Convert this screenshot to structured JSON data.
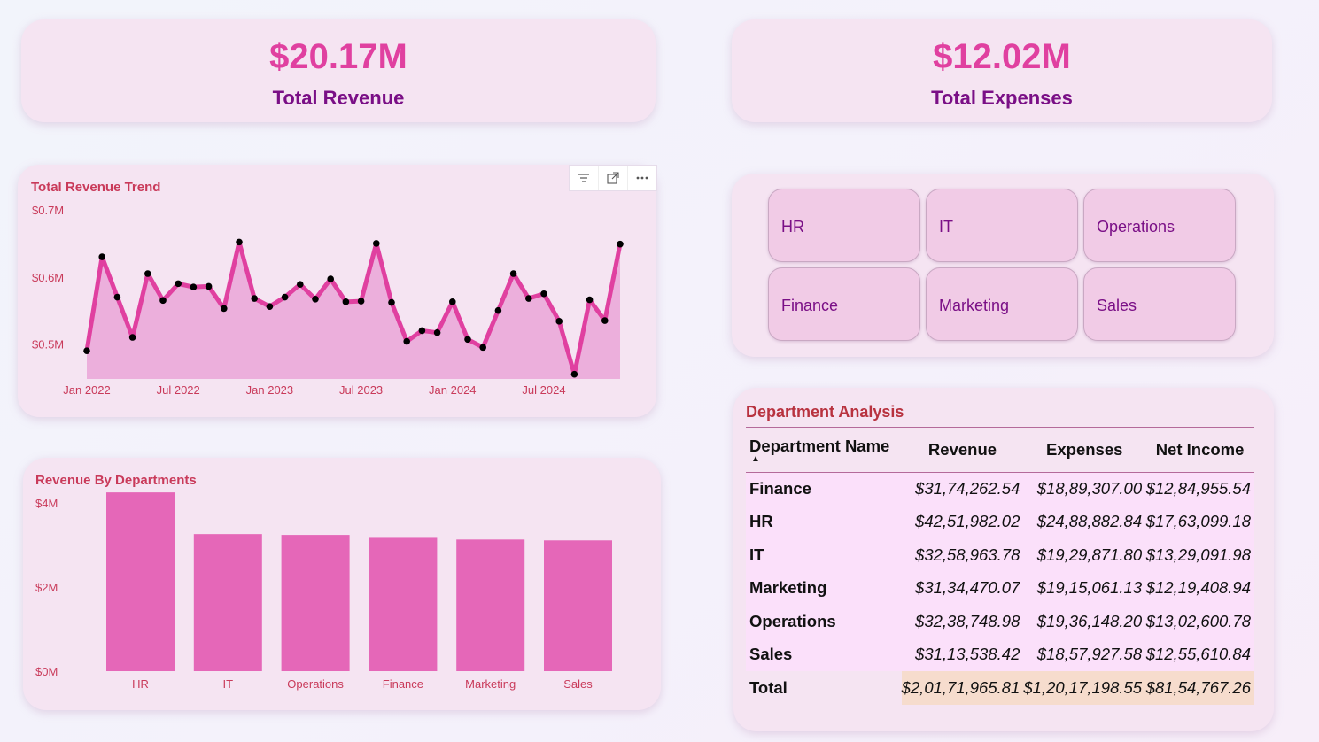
{
  "kpis": [
    {
      "value": "$20.17M",
      "label": "Total Revenue"
    },
    {
      "value": "$12.02M",
      "label": "Total Expenses"
    }
  ],
  "toolbar": {
    "filter_icon": "filter-icon",
    "focus_icon": "focus-mode-icon",
    "more_icon": "more-options-icon"
  },
  "slicer": {
    "items": [
      "HR",
      "IT",
      "Operations",
      "Finance",
      "Marketing",
      "Sales"
    ]
  },
  "table": {
    "title": "Department Analysis",
    "headers": [
      "Department Name",
      "Revenue",
      "Expenses",
      "Net Income"
    ],
    "sort_indicator": "▲",
    "rows": [
      [
        "Finance",
        "$31,74,262.54",
        "$18,89,307.00",
        "$12,84,955.54"
      ],
      [
        "HR",
        "$42,51,982.02",
        "$24,88,882.84",
        "$17,63,099.18"
      ],
      [
        "IT",
        "$32,58,963.78",
        "$19,29,871.80",
        "$13,29,091.98"
      ],
      [
        "Marketing",
        "$31,34,470.07",
        "$19,15,061.13",
        "$12,19,408.94"
      ],
      [
        "Operations",
        "$32,38,748.98",
        "$19,36,148.20",
        "$13,02,600.78"
      ],
      [
        "Sales",
        "$31,13,538.42",
        "$18,57,927.58",
        "$12,55,610.84"
      ]
    ],
    "total": [
      "Total",
      "$2,01,71,965.81",
      "$1,20,17,198.55",
      "$81,54,767.26"
    ]
  },
  "colors": {
    "accent": "#e040a0",
    "title": "#7a0f86",
    "line": "#e040a0",
    "area": "#eaa6d8",
    "bar": "#e567b8",
    "axis_text": "#c93a5a"
  },
  "chart_data": [
    {
      "type": "area",
      "title": "Total Revenue Trend",
      "xlabel": "",
      "ylabel": "",
      "x_tick_labels": [
        "Jan 2022",
        "Jul 2022",
        "Jan 2023",
        "Jul 2023",
        "Jan 2024",
        "Jul 2024"
      ],
      "x_tick_index": [
        0,
        6,
        12,
        18,
        24,
        30
      ],
      "y_tick_labels": [
        "$0.5M",
        "$0.6M",
        "$0.7M"
      ],
      "y_ticks": [
        0.5,
        0.6,
        0.7
      ],
      "ylim": [
        0.448,
        0.7
      ],
      "grid": false,
      "x": [
        "Jan 2022",
        "Feb 2022",
        "Mar 2022",
        "Apr 2022",
        "May 2022",
        "Jun 2022",
        "Jul 2022",
        "Aug 2022",
        "Sep 2022",
        "Oct 2022",
        "Nov 2022",
        "Dec 2022",
        "Jan 2023",
        "Feb 2023",
        "Mar 2023",
        "Apr 2023",
        "May 2023",
        "Jun 2023",
        "Jul 2023",
        "Aug 2023",
        "Sep 2023",
        "Oct 2023",
        "Nov 2023",
        "Dec 2023",
        "Jan 2024",
        "Feb 2024",
        "Mar 2024",
        "Apr 2024",
        "May 2024",
        "Jun 2024",
        "Jul 2024",
        "Aug 2024",
        "Sep 2024",
        "Oct 2024",
        "Nov 2024",
        "Dec 2024"
      ],
      "series": [
        {
          "values": [
            0.49,
            0.63,
            0.57,
            0.51,
            0.605,
            0.565,
            0.59,
            0.585,
            0.586,
            0.553,
            0.652,
            0.568,
            0.556,
            0.57,
            0.589,
            0.567,
            0.597,
            0.563,
            0.564,
            0.65,
            0.562,
            0.504,
            0.52,
            0.517,
            0.563,
            0.507,
            0.495,
            0.55,
            0.605,
            0.568,
            0.575,
            0.534,
            0.455,
            0.566,
            0.535,
            0.649
          ]
        }
      ]
    },
    {
      "type": "bar",
      "title": "Revenue By Departments",
      "xlabel": "",
      "ylabel": "",
      "categories": [
        "HR",
        "IT",
        "Operations",
        "Finance",
        "Marketing",
        "Sales"
      ],
      "values": [
        4.25,
        3.26,
        3.24,
        3.17,
        3.13,
        3.11
      ],
      "y_tick_labels": [
        "$0M",
        "$2M",
        "$4M"
      ],
      "y_ticks": [
        0,
        2,
        4
      ],
      "ylim": [
        0,
        4.8
      ],
      "grid": false
    }
  ]
}
